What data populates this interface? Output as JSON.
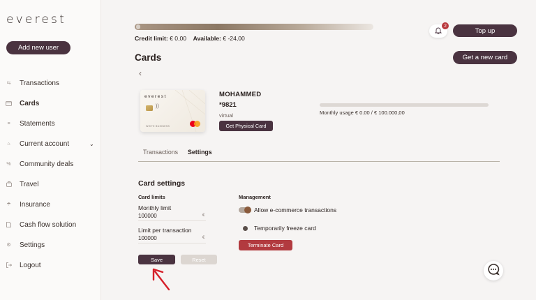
{
  "app": {
    "logo": "everest"
  },
  "sidebar": {
    "add_user_label": "Add new user",
    "items": [
      {
        "label": "Transactions",
        "icon": "transactions-icon"
      },
      {
        "label": "Cards",
        "icon": "card-icon",
        "active": true
      },
      {
        "label": "Statements",
        "icon": "statements-icon"
      },
      {
        "label": "Current account",
        "icon": "bank-icon",
        "expandable": true
      },
      {
        "label": "Community deals",
        "icon": "percent-icon"
      },
      {
        "label": "Travel",
        "icon": "suitcase-icon"
      },
      {
        "label": "Insurance",
        "icon": "umbrella-icon"
      },
      {
        "label": "Cash flow solution",
        "icon": "document-icon"
      },
      {
        "label": "Settings",
        "icon": "gear-icon"
      },
      {
        "label": "Logout",
        "icon": "logout-icon"
      }
    ]
  },
  "header": {
    "credit_limit_label": "Credit limit:",
    "credit_limit_value": "€ 0,00",
    "available_label": "Available:",
    "available_value": "€ -24,00",
    "notification_count": "2",
    "topup_label": "Top up"
  },
  "main": {
    "title": "Cards",
    "new_card_label": "Get a new card",
    "back_glyph": "‹",
    "card": {
      "brand_text": "everest",
      "small_text": "WHITE BUSINESS",
      "holder": "MOHAMMED",
      "number": "*9821",
      "type": "virtual",
      "physical_label": "Get Physical Card",
      "usage_text": "Monthly usage € 0.00 / € 100.000,00",
      "usage_fraction": 0.0
    },
    "tabs": [
      {
        "label": "Transactions"
      },
      {
        "label": "Settings",
        "active": true
      }
    ],
    "settings": {
      "title": "Card settings",
      "limits_title": "Card limits",
      "monthly_label": "Monthly limit",
      "monthly_value": "100000",
      "monthly_unit": "€",
      "per_tx_label": "Limit per transaction",
      "per_tx_value": "100000",
      "per_tx_unit": "€",
      "management_title": "Management",
      "ecommerce_label": "Allow e-commerce transactions",
      "ecommerce_on": true,
      "freeze_label": "Temporarily freeze card",
      "freeze_on": false,
      "terminate_label": "Terminate Card",
      "save_label": "Save",
      "reset_label": "Reset"
    }
  },
  "colors": {
    "brand": "#4a3340",
    "danger": "#b23a3f",
    "annotation_arrow": "#d6202a"
  }
}
